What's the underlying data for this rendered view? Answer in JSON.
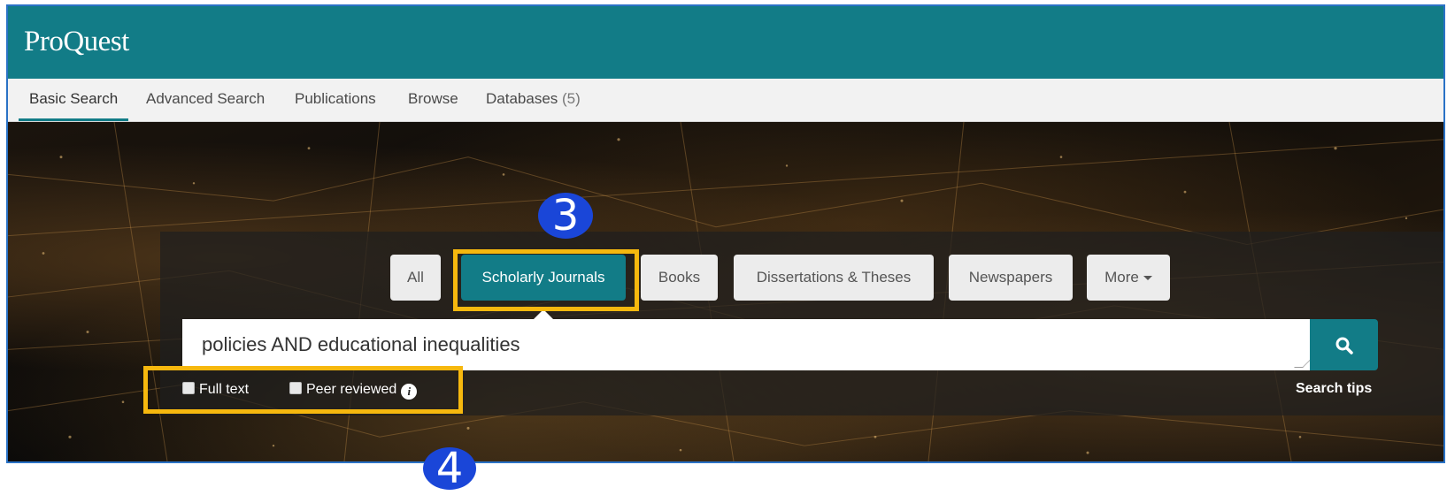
{
  "app": {
    "logo_text": "ProQuest",
    "brand_color": "#127c87"
  },
  "nav": {
    "items": [
      {
        "label": "Basic Search",
        "active": true
      },
      {
        "label": "Advanced Search"
      },
      {
        "label": "Publications"
      },
      {
        "label": "Browse"
      },
      {
        "label": "Databases",
        "count": "(5)"
      }
    ]
  },
  "source_tabs": {
    "items": [
      {
        "label": "All"
      },
      {
        "label": "Scholarly Journals",
        "active": true
      },
      {
        "label": "Books"
      },
      {
        "label": "Dissertations & Theses"
      },
      {
        "label": "Newspapers"
      },
      {
        "label": "More",
        "icon": "caret-down-icon"
      }
    ]
  },
  "search": {
    "query": "policies AND educational inequalities",
    "button_icon": "search-icon"
  },
  "filters": {
    "full_text": {
      "label": "Full text",
      "checked": false
    },
    "peer_reviewed": {
      "label": "Peer reviewed",
      "checked": false,
      "icon": "info-icon"
    }
  },
  "search_tips": "Search tips",
  "annotations": {
    "callout_3": "3",
    "callout_4": "4",
    "highlight_color": "#f6b80e",
    "callout_color": "#1a46d8"
  }
}
